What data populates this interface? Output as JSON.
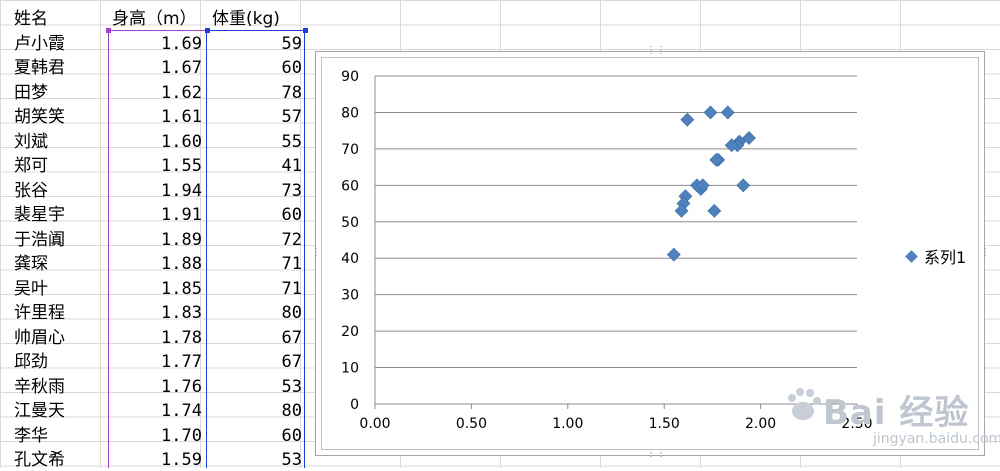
{
  "sheet": {
    "headers": {
      "name": "姓名",
      "height": "身高（m）",
      "weight": "体重(kg)"
    },
    "rows": [
      {
        "name": "卢小霞",
        "height": "1.69",
        "weight": "59"
      },
      {
        "name": "夏韩君",
        "height": "1.67",
        "weight": "60"
      },
      {
        "name": "田梦",
        "height": "1.62",
        "weight": "78"
      },
      {
        "name": "胡笑笑",
        "height": "1.61",
        "weight": "57"
      },
      {
        "name": "刘斌",
        "height": "1.60",
        "weight": "55"
      },
      {
        "name": "郑可",
        "height": "1.55",
        "weight": "41"
      },
      {
        "name": "张谷",
        "height": "1.94",
        "weight": "73"
      },
      {
        "name": "裴星宇",
        "height": "1.91",
        "weight": "60"
      },
      {
        "name": "于浩阗",
        "height": "1.89",
        "weight": "72"
      },
      {
        "name": "龚琛",
        "height": "1.88",
        "weight": "71"
      },
      {
        "name": "吴叶",
        "height": "1.85",
        "weight": "71"
      },
      {
        "name": "许里程",
        "height": "1.83",
        "weight": "80"
      },
      {
        "name": "帅眉心",
        "height": "1.78",
        "weight": "67"
      },
      {
        "name": "邱劲",
        "height": "1.77",
        "weight": "67"
      },
      {
        "name": "辛秋雨",
        "height": "1.76",
        "weight": "53"
      },
      {
        "name": "江曼天",
        "height": "1.74",
        "weight": "80"
      },
      {
        "name": "李华",
        "height": "1.70",
        "weight": "60"
      },
      {
        "name": "孔文希",
        "height": "1.59",
        "weight": "53"
      }
    ]
  },
  "chart_data": {
    "type": "scatter",
    "title": "",
    "xlabel": "",
    "ylabel": "",
    "xlim": [
      0,
      2.5
    ],
    "ylim": [
      0,
      90
    ],
    "x_ticks": [
      "0.00",
      "0.50",
      "1.00",
      "1.50",
      "2.00",
      "2.50"
    ],
    "y_ticks": [
      "0",
      "10",
      "20",
      "30",
      "40",
      "50",
      "60",
      "70",
      "80",
      "90"
    ],
    "grid": "horizontal",
    "legend_position": "right",
    "marker": "diamond",
    "color": "#4f81bd",
    "series": [
      {
        "name": "系列1",
        "x": [
          1.69,
          1.67,
          1.62,
          1.61,
          1.6,
          1.55,
          1.94,
          1.91,
          1.89,
          1.88,
          1.85,
          1.83,
          1.78,
          1.77,
          1.76,
          1.74,
          1.7,
          1.59
        ],
        "y": [
          59,
          60,
          78,
          57,
          55,
          41,
          73,
          60,
          72,
          71,
          71,
          80,
          67,
          67,
          53,
          80,
          60,
          53
        ]
      }
    ]
  },
  "watermark": {
    "main": "Bai 经验",
    "url": "jingyan.baidu.com"
  }
}
